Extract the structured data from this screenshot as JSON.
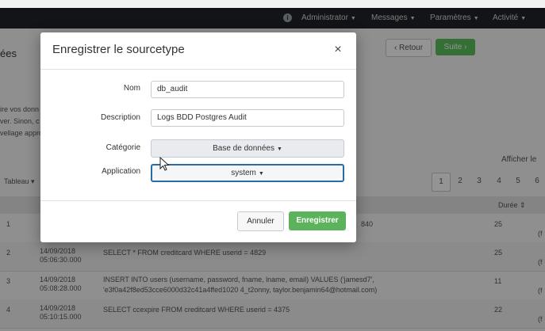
{
  "navbar": {
    "items": [
      {
        "label": "Administrator"
      },
      {
        "label": "Messages"
      },
      {
        "label": "Paramètres"
      },
      {
        "label": "Activité"
      }
    ]
  },
  "page": {
    "title": "ées",
    "back_label": "‹ Retour",
    "next_label": "Suite ›",
    "intro_lines": [
      "ire vos donn",
      "ver. Sinon, c",
      "vellage appro"
    ],
    "show_events": "Afficher le",
    "rows_selector": "Tableau ▾",
    "pagination": [
      "1",
      "2",
      "3",
      "4",
      "5",
      "6"
    ],
    "duration_header": "Durée ⇕"
  },
  "table": {
    "rows": [
      {
        "num": "1",
        "time": "",
        "query": "",
        "query2": "",
        "duration": "25",
        "tail": "(f"
      },
      {
        "num": "2",
        "time": "14/09/2018 05:06:30.000",
        "query": "SELECT * FROM creditcard WHERE userid = 4829",
        "query2": "",
        "duration": "25",
        "tail": "(f"
      },
      {
        "num": "3",
        "time": "14/09/2018 05:08:28.000",
        "query": "INSERT INTO users (username, password, fname, lname, email) VALUES ('jamesd7',",
        "query2": "'e3f0a42f8ed53cce6000d32c41a4ffed1020 4_t2onny, taylor.benjamin64@hotmail.com)",
        "duration": "11",
        "tail": "(f"
      },
      {
        "num": "4",
        "time": "14/09/2018 05:10:15.000",
        "query": "SELECT ccexpire FROM creditcard WHERE userid = 4375",
        "query2": "",
        "duration": "22",
        "tail": "(f"
      }
    ],
    "row1_partial": "840"
  },
  "modal": {
    "title": "Enregistrer le sourcetype",
    "close_glyph": "×",
    "fields": {
      "name_label": "Nom",
      "name_value": "db_audit",
      "description_label": "Description",
      "description_value": "Logs BDD Postgres Audit",
      "category_label": "Catégorie",
      "category_value": "Base de données",
      "application_label": "Application",
      "application_value": "system"
    },
    "cancel_label": "Annuler",
    "save_label": "Enregistrer"
  },
  "colors": {
    "primary_green": "#5cb35c",
    "focus_blue": "#2b6ba5",
    "navbar": "#1f2329"
  }
}
